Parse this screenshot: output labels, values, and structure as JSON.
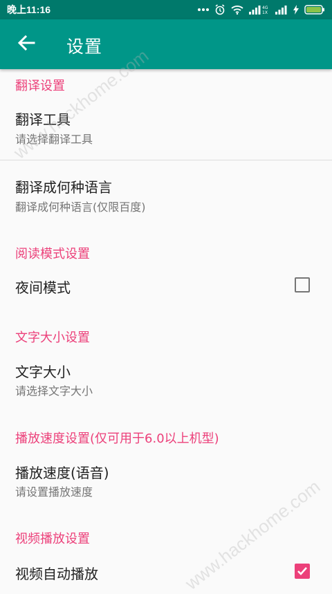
{
  "status_bar": {
    "time": "晚上11:16",
    "icons": [
      "more-dots-icon",
      "alarm-icon",
      "wifi-icon",
      "signal-4g-icon",
      "signal-icon",
      "charging-icon",
      "battery-icon"
    ]
  },
  "app_bar": {
    "title": "设置",
    "back_icon": "back-arrow-icon",
    "color": "#009688"
  },
  "sections": {
    "translate": {
      "header": "翻译设置",
      "tool": {
        "title": "翻译工具",
        "summary": "请选择翻译工具"
      },
      "language": {
        "title": "翻译成何种语言",
        "summary": "翻译成何种语言(仅限百度)"
      }
    },
    "reading": {
      "header": "阅读模式设置",
      "night_mode": {
        "title": "夜间模式",
        "checked": false
      }
    },
    "font_size": {
      "header": "文字大小设置",
      "size": {
        "title": "文字大小",
        "summary": "请选择文字大小"
      }
    },
    "speed": {
      "header": "播放速度设置(仅可用于6.0以上机型)",
      "speed_voice": {
        "title": "播放速度(语音)",
        "summary": "请设置播放速度"
      }
    },
    "video": {
      "header": "视频播放设置",
      "autoplay": {
        "title": "视频自动播放",
        "checked": true
      }
    }
  },
  "watermark": "www.hackhome.com",
  "colors": {
    "accent": "#ec407a",
    "primary": "#009688",
    "primary_dark": "#00796b"
  }
}
